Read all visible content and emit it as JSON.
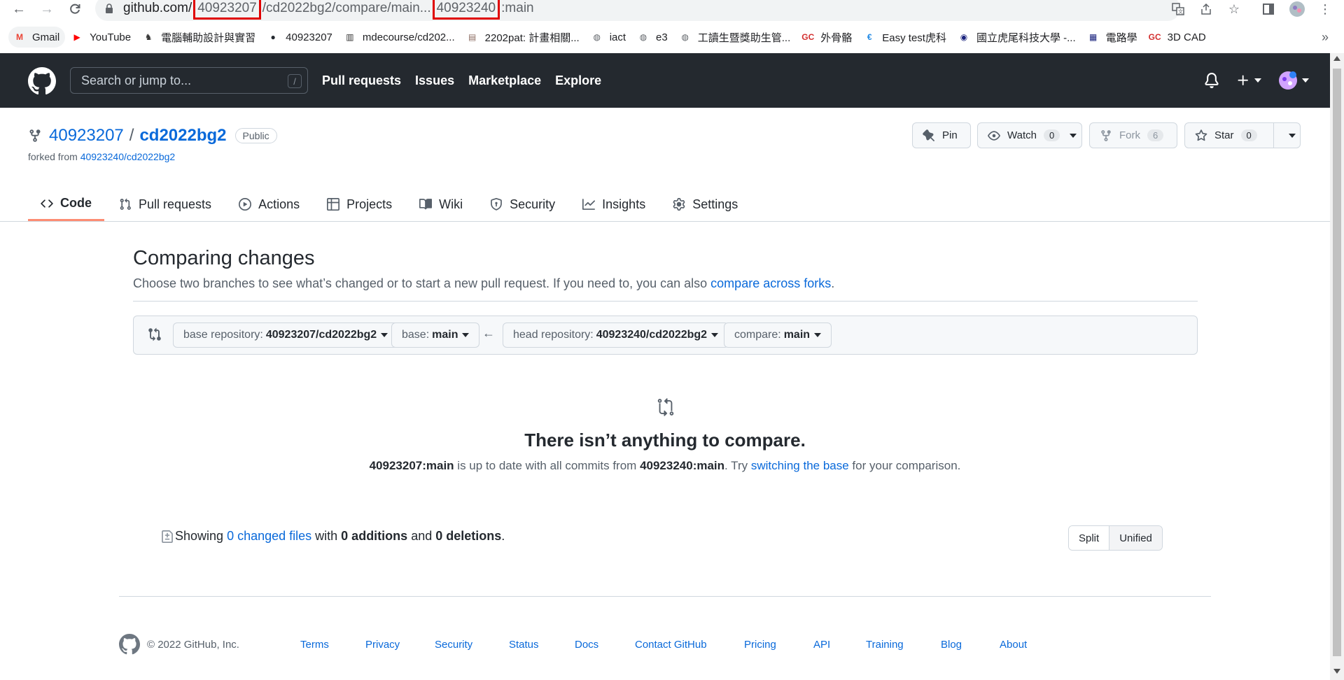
{
  "browser": {
    "url": {
      "host": "github.com/",
      "owner": "40923207",
      "middle": "/cd2022bg2/compare/main...",
      "head_owner": "40923240",
      "tail": ":main"
    },
    "bookmarks": [
      {
        "label": "Gmail",
        "icon": "gmail-icon",
        "color": "#ea4335"
      },
      {
        "label": "YouTube",
        "icon": "youtube-icon",
        "color": "#ff0000"
      },
      {
        "label": "電腦輔助設計與實習",
        "icon": "deer-icon",
        "color": "#333333"
      },
      {
        "label": "40923207",
        "icon": "github-icon",
        "color": "#24292f"
      },
      {
        "label": "mdecourse/cd202...",
        "icon": "bars-icon",
        "color": "#333333"
      },
      {
        "label": "2202pat: 計畫相關...",
        "icon": "page-icon",
        "color": "#8d6e63"
      },
      {
        "label": "iact",
        "icon": "globe-icon",
        "color": "#5f6368"
      },
      {
        "label": "e3",
        "icon": "globe-icon",
        "color": "#5f6368"
      },
      {
        "label": "工讀生暨獎助生管...",
        "icon": "globe-icon",
        "color": "#5f6368"
      },
      {
        "label": "外骨骼",
        "icon": "gc-icon",
        "color": "#d32f2f"
      },
      {
        "label": "Easy test虎科",
        "icon": "easytest-icon",
        "color": "#1e88e5"
      },
      {
        "label": "國立虎尾科技大學 -...",
        "icon": "nfu-icon",
        "color": "#1a237e"
      },
      {
        "label": "電路學",
        "icon": "grid-icon",
        "color": "#1a237e"
      },
      {
        "label": "3D CAD",
        "icon": "gc-icon",
        "color": "#d32f2f"
      }
    ],
    "more": "»"
  },
  "header": {
    "search_placeholder": "Search or jump to...",
    "search_shortcut": "/",
    "nav": [
      "Pull requests",
      "Issues",
      "Marketplace",
      "Explore"
    ]
  },
  "repo": {
    "owner": "40923207",
    "separator": "/",
    "name": "cd2022bg2",
    "visibility": "Public",
    "forked_prefix": "forked from",
    "forked_link": "40923240/cd2022bg2",
    "actions": {
      "pin": "Pin",
      "watch": "Watch",
      "watch_count": "0",
      "fork": "Fork",
      "fork_count": "6",
      "star": "Star",
      "star_count": "0"
    },
    "tabs": [
      {
        "label": "Code",
        "icon": "code-icon"
      },
      {
        "label": "Pull requests",
        "icon": "pull-request-icon"
      },
      {
        "label": "Actions",
        "icon": "play-icon"
      },
      {
        "label": "Projects",
        "icon": "table-icon"
      },
      {
        "label": "Wiki",
        "icon": "book-icon"
      },
      {
        "label": "Security",
        "icon": "shield-icon"
      },
      {
        "label": "Insights",
        "icon": "graph-icon"
      },
      {
        "label": "Settings",
        "icon": "gear-icon"
      }
    ]
  },
  "compare": {
    "title": "Comparing changes",
    "desc_text": "Choose two branches to see what’s changed or to start a new pull request. If you need to, you can also ",
    "desc_link": "compare across forks",
    "desc_end": ".",
    "base_repo_label": "base repository:",
    "base_repo_value": "40923207/cd2022bg2",
    "base_label": "base:",
    "base_value": "main",
    "arrow": "←",
    "head_repo_label": "head repository:",
    "head_repo_value": "40923240/cd2022bg2",
    "compare_label": "compare:",
    "compare_value": "main"
  },
  "blankslate": {
    "title": "There isn’t anything to compare.",
    "ref_base": "40923207:main",
    "text1": " is up to date with all commits from ",
    "ref_head": "40923240:main",
    "text2": ". Try ",
    "link": "switching the base",
    "text3": " for your comparison."
  },
  "diffstat": {
    "showing": "Showing",
    "files_link": "0 changed files",
    "with": " with ",
    "additions": "0 additions",
    "and": " and ",
    "deletions": "0 deletions",
    "end": ".",
    "split": "Split",
    "unified": "Unified"
  },
  "footer": {
    "copyright": "© 2022 GitHub, Inc.",
    "links": [
      "Terms",
      "Privacy",
      "Security",
      "Status",
      "Docs",
      "Contact GitHub",
      "Pricing",
      "API",
      "Training",
      "Blog",
      "About"
    ]
  }
}
